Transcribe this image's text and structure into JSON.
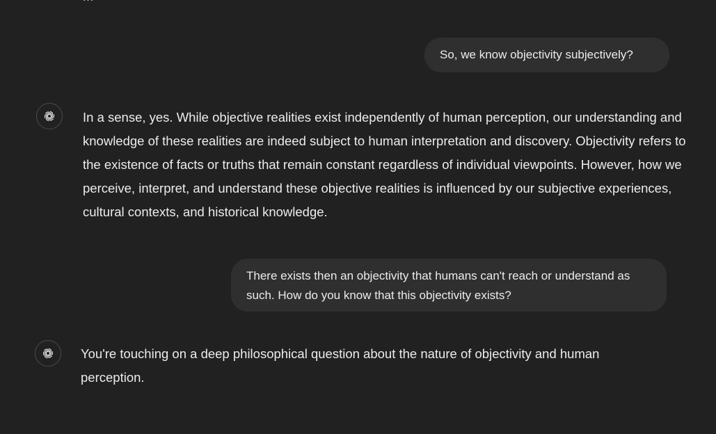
{
  "conversation": {
    "clipped_previous_text": "…",
    "messages": [
      {
        "role": "user",
        "text": "So, we know objectivity subjectively?"
      },
      {
        "role": "assistant",
        "avatar_icon": "openai-logo-icon",
        "text": "In a sense, yes. While objective realities exist independently of human perception, our understanding and knowledge of these realities are indeed subject to human interpretation and discovery. Objectivity refers to the existence of facts or truths that remain constant regardless of individual viewpoints. However, how we perceive, interpret, and understand these objective realities is influenced by our subjective experiences, cultural contexts, and historical knowledge."
      },
      {
        "role": "user",
        "text": "There exists then an objectivity that humans can't reach or understand as such. How do you know that this objectivity exists?"
      },
      {
        "role": "assistant",
        "avatar_icon": "openai-logo-icon",
        "text": "You're touching on a deep philosophical question about the nature of objectivity and human perception."
      }
    ]
  },
  "colors": {
    "background": "#212121",
    "user_bubble": "#2f2f2f",
    "text": "#ececec"
  }
}
